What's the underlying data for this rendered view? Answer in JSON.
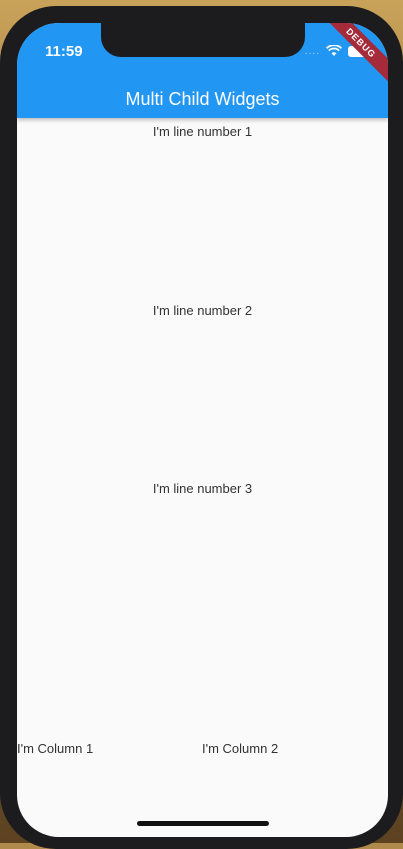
{
  "status_bar": {
    "time": "11:59",
    "signal": "....",
    "wifi_icon": "wifi-icon",
    "battery_icon": "battery-icon"
  },
  "debug_banner": "DEBUG",
  "app_bar": {
    "title": "Multi Child Widgets",
    "color": "#2196f3"
  },
  "body": {
    "lines": [
      "I'm line number 1",
      "I'm line number 2",
      "I'm line number 3"
    ],
    "columns": [
      "I'm Column 1",
      "I'm Column 2"
    ]
  }
}
